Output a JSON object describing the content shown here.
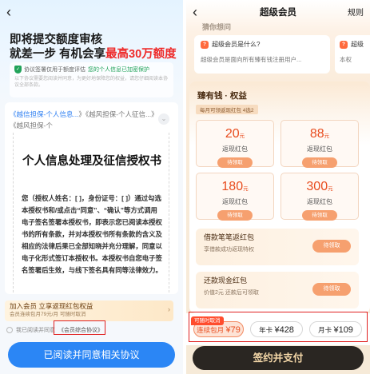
{
  "left": {
    "back_icon": "chevron-left-icon",
    "headline1": "即将提交额度审核",
    "headline2_prefix": "就差一步 有机会享",
    "headline2_highlight": "最高30万额度",
    "privacy_text": "协议签署仅用于额度评估",
    "privacy_protect": "您的个人信息已加密保护",
    "privacy_detail": "以下协议需要您阅读并同意，为更好地保障您的权益，请您仔细阅读本协议全部条款。",
    "links_blue": "《越信担保-个人信息...",
    "links_rest": "》《越风担保-个人征信...》《越风担保-个",
    "agreement_title": "个人信息处理及征信授权书",
    "agreement_body": "您（授权人姓名：[ ]，身份证号：[ ]）通过勾选本授权书和/或点击“同意”、“确认”等方式调用电子签名签署本授权书，即表示您已阅读本授权书的所有条款，并对本授权书所有条款的含义及相应的法律后果已全部知晓并充分理解，同意以电子化形式签订本授权书。本授权书自您电子签名签署后生效，与线下签名具有同等法律效力。",
    "promo_title": "加入会员 立享返现红包权益",
    "promo_sub": "会员连续包月79元/月 可随时取消",
    "agree_prefix": "我已阅读并同意",
    "agree_link": "《会员综合协议》",
    "agree_button": "已阅读并同意相关协议"
  },
  "right": {
    "back_icon": "chevron-left-icon",
    "title": "超级会员",
    "rules": "规则",
    "cut_heading": "猜你想问",
    "faq_question": "超级会员是什么?",
    "faq_answer": "超级会员是面向所有臻有钱注册用户...",
    "faq2_question": "超级",
    "faq2_answer": "本权",
    "benefits_title": "臻有钱 · 权益",
    "monthly_tag": "每月可领返现红包 4选2",
    "coupons": [
      {
        "amount": "20",
        "unit": "元",
        "label": "返现红包",
        "action": "待领取"
      },
      {
        "amount": "88",
        "unit": "元",
        "label": "返现红包",
        "action": "待领取"
      },
      {
        "amount": "180",
        "unit": "元",
        "label": "返现红包",
        "action": "待领取"
      },
      {
        "amount": "300",
        "unit": "元",
        "label": "返现红包",
        "action": "待领取"
      }
    ],
    "perks": [
      {
        "title": "借款笔笔返红包",
        "sub": "享借款成功返现特权",
        "action": "待领取"
      },
      {
        "title": "还款现金红包",
        "sub": "价值2元 还款后可领取",
        "action": "待领取"
      }
    ],
    "cancel_tag": "可随时取消",
    "plans": [
      {
        "name": "连续包月",
        "price": "¥79"
      },
      {
        "name": "年卡",
        "price": "¥428"
      },
      {
        "name": "月卡",
        "price": "¥109"
      }
    ],
    "sign_button": "签约并支付"
  }
}
